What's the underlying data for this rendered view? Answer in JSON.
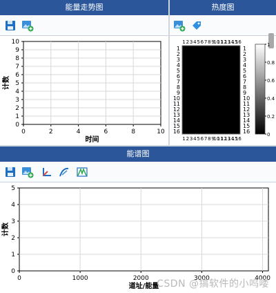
{
  "energy_panel": {
    "title": "能量走势图",
    "toolbar": {
      "save_icon": "save-icon",
      "image_icon": "image-add-icon"
    },
    "chart_data": {
      "type": "line",
      "xlabel": "时间",
      "ylabel": "计数",
      "xlim": [
        0,
        10
      ],
      "ylim": [
        0,
        10
      ],
      "x_ticks": [
        "0",
        "2",
        "4",
        "6",
        "8",
        "10"
      ],
      "y_ticks": [
        "0",
        "1",
        "2",
        "3",
        "4",
        "5",
        "6",
        "7",
        "8",
        "9",
        "10"
      ],
      "grid": true,
      "series": []
    }
  },
  "heatmap_panel": {
    "title": "热度图",
    "toolbar": {
      "image_icon": "image-add-icon",
      "tag_icon": "tag-icon"
    },
    "chart_data": {
      "type": "heatmap",
      "top_labels": [
        "1",
        "2",
        "3",
        "4",
        "5",
        "6",
        "7",
        "8",
        "9",
        "10",
        "11",
        "12",
        "13",
        "14",
        "15",
        "16"
      ],
      "left_labels": [
        "1",
        "2",
        "3",
        "4",
        "5",
        "6",
        "7",
        "8",
        "9",
        "10",
        "11",
        "12",
        "13",
        "14",
        "15",
        "16"
      ],
      "right_labels": [
        "1",
        "2",
        "3",
        "4",
        "5",
        "6",
        "7",
        "8",
        "9",
        "10",
        "11",
        "12",
        "13",
        "14",
        "15",
        "16"
      ],
      "bottom_labels": [
        "1",
        "2",
        "3",
        "4",
        "5",
        "6",
        "7",
        "8",
        "9",
        "10",
        "11",
        "12",
        "13",
        "14",
        "15",
        "16"
      ],
      "all_zero": true,
      "colorbar_ticks": [
        "1",
        "0.8",
        "0.6",
        "0.4",
        "0.2",
        "0"
      ],
      "colorbar_range": [
        0,
        1
      ]
    }
  },
  "spectrum_panel": {
    "title": "能谱图",
    "toolbar": {
      "save_icon": "save-icon",
      "image_icon": "image-add-icon",
      "angle_icon": "angle-icon",
      "curve_icon": "curve-icon",
      "peak_icon": "peak-icon"
    },
    "chart_data": {
      "type": "line",
      "xlabel": "道址/能量",
      "ylabel": "计数",
      "xlim": [
        0,
        4096
      ],
      "ylim": [
        0,
        5
      ],
      "x_ticks": [
        "0",
        "1000",
        "2000",
        "3000",
        "4000"
      ],
      "y_ticks": [
        "0",
        "1",
        "2",
        "3",
        "4",
        "5"
      ],
      "grid": true,
      "series": []
    }
  },
  "watermark": "CSDN @搞软件的小呜喽",
  "colors": {
    "title_bar": "#2b579a",
    "grid": "#d7d7d7",
    "heatmap_cell": "#000000"
  }
}
